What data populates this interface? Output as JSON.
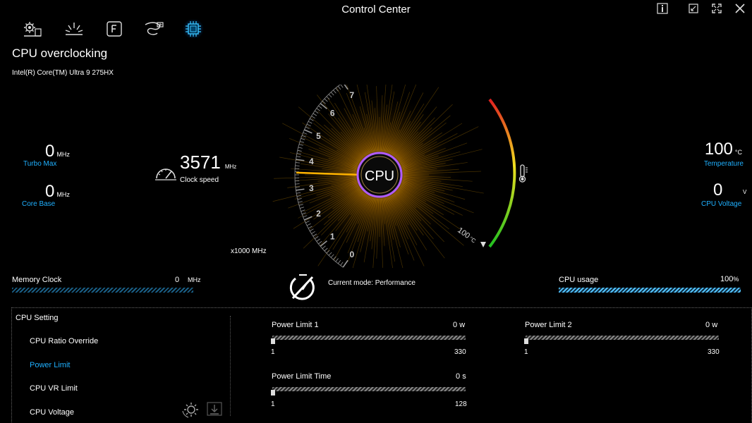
{
  "window": {
    "title": "Control Center"
  },
  "page": {
    "title": "CPU overclocking",
    "cpu_name": "Intel(R) Core(TM) Ultra 9 275HX"
  },
  "left_stats": {
    "turbo_max": {
      "value": "0",
      "unit": "MHz",
      "label": "Turbo Max"
    },
    "core_base": {
      "value": "0",
      "unit": "MHz",
      "label": "Core Base"
    }
  },
  "clock": {
    "value": "3571",
    "unit": "MHz",
    "label": "Clock speed"
  },
  "gauge": {
    "center_label": "CPU",
    "ticks": [
      "0",
      "1",
      "2",
      "3",
      "4",
      "5",
      "6",
      "7"
    ],
    "scale_label": "x1000 MHz",
    "value": 3.571,
    "temp_mark": "100",
    "temp_mark_unit": "°C",
    "colors": {
      "needle": "#ffb300",
      "ring": "#b05cff",
      "glow": "#ffb000",
      "temp_high": "#e02020",
      "temp_mid": "#f0e020",
      "temp_low": "#20c020"
    }
  },
  "right_stats": {
    "temperature": {
      "value": "100",
      "unit": "°C",
      "label": "Temperature"
    },
    "cpu_voltage": {
      "value": "0",
      "unit": "V",
      "label": "CPU Voltage"
    }
  },
  "memory": {
    "label": "Memory Clock",
    "value": "0",
    "unit": "MHz",
    "fill": 0
  },
  "mode": {
    "text": "Current mode: Performance"
  },
  "cpu_usage": {
    "label": "CPU usage",
    "value": "100",
    "unit": "%",
    "fill": 1.0
  },
  "settings": {
    "header": "CPU Setting",
    "items": [
      "CPU Ratio Override",
      "Power Limit",
      "CPU VR Limit",
      "CPU Voltage"
    ],
    "active_index": 1
  },
  "sliders": {
    "pl1": {
      "label": "Power Limit 1",
      "value": "0",
      "unit": "w",
      "min": "1",
      "max": "330"
    },
    "pl2": {
      "label": "Power Limit 2",
      "value": "0",
      "unit": "w",
      "min": "1",
      "max": "330"
    },
    "plt": {
      "label": "Power Limit Time",
      "value": "0",
      "unit": "s",
      "min": "1",
      "max": "128"
    }
  },
  "icons": {
    "nav": [
      "settings-panel-icon",
      "brightness-icon",
      "function-key-icon",
      "fan-icon",
      "cpu-chip-icon"
    ],
    "window": [
      "info-icon",
      "minimize-icon",
      "fullscreen-icon",
      "close-icon"
    ]
  },
  "accent_color": "#1fb0ff"
}
